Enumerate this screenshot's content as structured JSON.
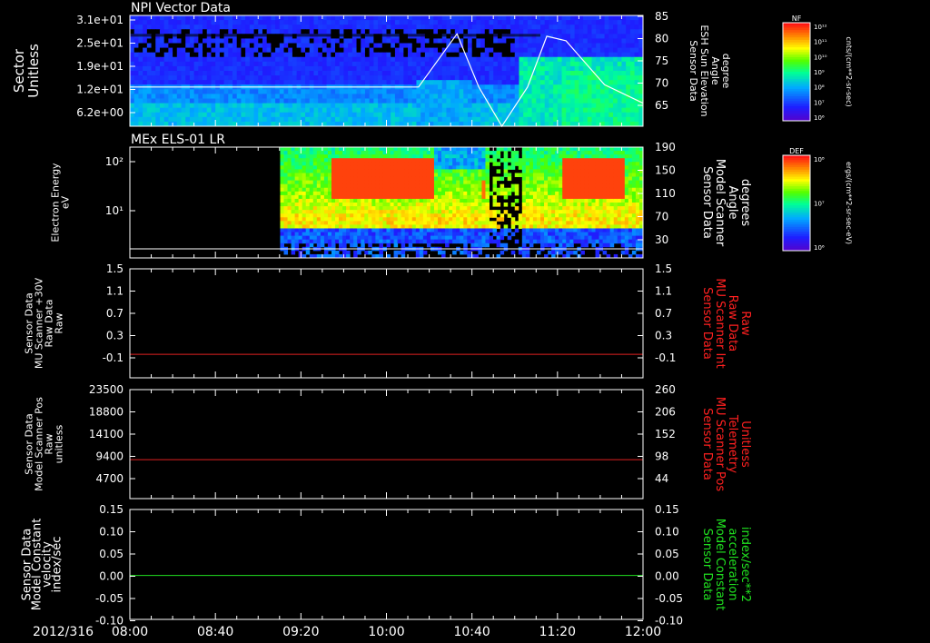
{
  "time_axis": {
    "date_label": "2012/316",
    "ticks": [
      "08:00",
      "08:40",
      "09:20",
      "10:00",
      "10:40",
      "11:20",
      "12:00"
    ]
  },
  "chart_data": [
    {
      "type": "heatmap",
      "title": "NPI Vector Data",
      "ylabel": [
        "Sector",
        "Unitless"
      ],
      "yticks": [
        "3.1e+01",
        "2.5e+01",
        "1.9e+01",
        "1.2e+01",
        "6.2e+00"
      ],
      "right_ylabel": [
        "Sensor Data",
        "ESH Sun Elevation",
        "Angle",
        "degree"
      ],
      "right_yticks": [
        "85",
        "80",
        "75",
        "70",
        "65"
      ],
      "right_ylim": [
        61,
        85
      ],
      "overlay_series": {
        "name": "ESH Sun Elevation Angle",
        "x_hours": [
          8.0,
          10.25,
          10.55,
          10.72,
          10.9,
          11.1,
          11.25,
          11.4,
          11.7,
          12.0
        ],
        "y": [
          69.5,
          69.5,
          81,
          69.5,
          61,
          69.5,
          80.5,
          79.5,
          70,
          66
        ]
      },
      "colorbar": {
        "label": "NF",
        "units": "cnts/(cm**2-sr-sec)",
        "ticks": [
          "10¹²",
          "10¹¹",
          "10¹⁰",
          "10⁹",
          "10⁸",
          "10⁷",
          "10⁶"
        ]
      }
    },
    {
      "type": "heatmap",
      "title": "MEx ELS-01 LR",
      "ylabel": [
        "Electron Energy",
        "eV"
      ],
      "yticks": [
        "10²",
        "10¹"
      ],
      "right_ylabel": [
        "Sensor Data",
        "Model Scanner",
        "Angle",
        "degrees"
      ],
      "right_yticks": [
        "190",
        "150",
        "110",
        "70",
        "30"
      ],
      "overlay_series": {
        "name": "Model Scanner Angle",
        "y_const": 12
      },
      "colorbar": {
        "label": "DEF",
        "units": "ergs/(cm**2-sr-sec-eV)",
        "ticks": [
          "10⁸",
          "10⁷",
          "10⁶"
        ]
      }
    },
    {
      "type": "line",
      "ylabel": [
        "Sensor Data",
        "MU Scanner +30V",
        "Raw Data",
        "Raw"
      ],
      "yticks": [
        "1.5",
        "1.1",
        "0.7",
        "0.3",
        "-0.1"
      ],
      "right_ylabel": [
        "Sensor Data",
        "MU Scanner Int",
        "Raw Data",
        "Raw"
      ],
      "right_yticks": [
        "1.5",
        "1.1",
        "0.7",
        "0.3",
        "-0.1"
      ],
      "ylim": [
        -0.45,
        1.5
      ],
      "series": [
        {
          "value": -0.03,
          "color": "#e02020"
        }
      ]
    },
    {
      "type": "line",
      "ylabel": [
        "Sensor Data",
        "Model Scanner Pos",
        "Raw",
        "unitless"
      ],
      "yticks": [
        "23500",
        "18800",
        "14100",
        "9400",
        "4700"
      ],
      "right_ylabel": [
        "Sensor Data",
        "MU Scanner Pos",
        "Telemetry",
        "Unitless"
      ],
      "right_yticks": [
        "260",
        "206",
        "152",
        "98",
        "44"
      ],
      "ylim": [
        0,
        23500
      ],
      "series": [
        {
          "value": 8400,
          "color": "#e02020"
        }
      ]
    },
    {
      "type": "line",
      "ylabel": [
        "Sensor Data",
        "Model Constant",
        "velocity",
        "index/sec"
      ],
      "yticks": [
        "0.15",
        "0.10",
        "0.05",
        "0.00",
        "-0.05",
        "-0.10"
      ],
      "right_ylabel": [
        "Sensor Data",
        "Model Constant",
        "acceleration",
        "index/sec**2"
      ],
      "right_yticks": [
        "0.15",
        "0.10",
        "0.05",
        "0.00",
        "-0.05",
        "-0.10"
      ],
      "ylim": [
        -0.1,
        0.15
      ],
      "series": [
        {
          "value": 0.0,
          "color": "#20e020"
        }
      ]
    }
  ],
  "colors": {
    "right_label_red": "#ff2020",
    "right_label_green": "#20e020",
    "axis": "#ffffff"
  }
}
